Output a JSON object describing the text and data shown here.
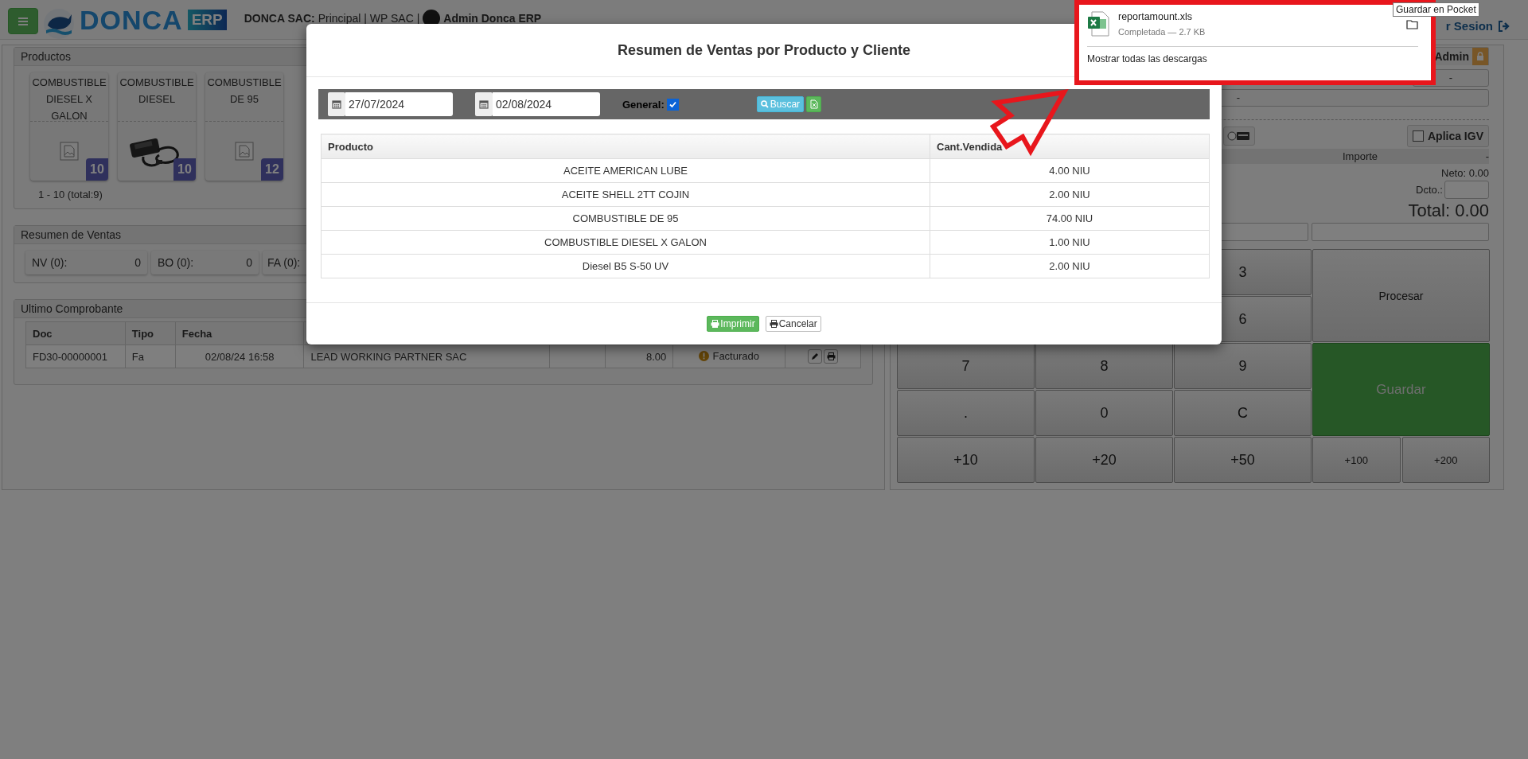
{
  "header": {
    "brand": "DONCA",
    "brand_tag": "ERP",
    "company_label": "DONCA SAC:",
    "company_info": "Principal | WP SAC |",
    "user": "Admin Donca ERP",
    "logout": "r Sesion"
  },
  "productos": {
    "title": "Productos",
    "items": [
      {
        "name": "COMBUSTIBLE DIESEL X GALON",
        "count": "10",
        "kind": "placeholder"
      },
      {
        "name": "COMBUSTIBLE DIESEL",
        "count": "10",
        "kind": "picture"
      },
      {
        "name": "COMBUSTIBLE DE 95",
        "count": "12",
        "kind": "placeholder"
      }
    ],
    "pagination": "1 - 10 (total:9)"
  },
  "resumen": {
    "title": "Resumen de Ventas",
    "items": [
      {
        "label": "NV (0):",
        "value": "0"
      },
      {
        "label": "BO (0):",
        "value": "0"
      },
      {
        "label": "FA (0):"
      }
    ]
  },
  "ultimo": {
    "title": "Ultimo Comprobante",
    "columns": [
      "Doc",
      "Tipo",
      "Fecha"
    ],
    "rows": [
      {
        "doc": "FD30-00000001",
        "tipo": "Fa",
        "fecha": "02/08/24 16:58",
        "cliente": "LEAD WORKING PARTNER SAC",
        "total": "8.00",
        "estado": "Facturado"
      }
    ]
  },
  "caja": {
    "user_tab": "Admin",
    "fields": [
      "-",
      "-"
    ],
    "igv": {
      "label": "Aplica IGV",
      "checked": false
    },
    "importe": {
      "label": "Importe",
      "value": "-"
    },
    "neto": "Neto: 0.00",
    "descuento": "Dcto.:",
    "total": "Total: 0.00",
    "keys": [
      "3",
      "6",
      "7",
      "8",
      "9",
      ".",
      "0",
      "C",
      "+10",
      "+20",
      "+50"
    ],
    "actions": [
      {
        "label": "Procesar",
        "kind": "procesar"
      },
      {
        "label": "Guardar",
        "kind": "guardar"
      },
      {
        "label": "+100",
        "kind": "small"
      },
      {
        "label": "+200",
        "kind": "small"
      }
    ]
  },
  "modal": {
    "title": "Resumen de Ventas por Producto y Cliente",
    "date_from": "27/07/2024",
    "date_to": "02/08/2024",
    "general": {
      "label": "General:",
      "checked": true
    },
    "search": "Buscar",
    "columns": [
      "Producto",
      "Cant.Vendida"
    ],
    "rows": [
      {
        "producto": "ACEITE AMERICAN LUBE",
        "cantidad": "4.00 NIU"
      },
      {
        "producto": "ACEITE SHELL 2TT COJIN",
        "cantidad": "2.00 NIU"
      },
      {
        "producto": "COMBUSTIBLE DE 95",
        "cantidad": "74.00 NIU"
      },
      {
        "producto": "COMBUSTIBLE DIESEL X GALON",
        "cantidad": "1.00 NIU"
      },
      {
        "producto": "Diesel B5 S-50 UV",
        "cantidad": "2.00 NIU"
      }
    ],
    "buttons": [
      {
        "label": "Imprimir",
        "kind": "primary"
      },
      {
        "label": "Cancelar",
        "kind": "default"
      }
    ]
  },
  "download": {
    "file": "reportamount.xls",
    "status": "Completada — 2.7 KB",
    "show_all": "Mostrar todas las descargas",
    "tooltip": "Guardar en Pocket"
  }
}
